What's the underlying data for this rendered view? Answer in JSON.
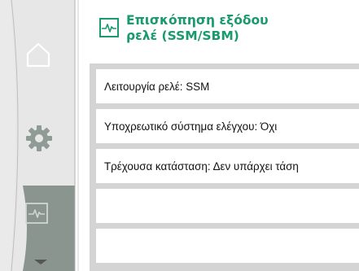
{
  "screen": {
    "title": "Επισκόπηση εξόδου\nρελέ (SSM/SBM)",
    "title_icon": "heartbeat-icon",
    "accent_color": "#1a9a6d"
  },
  "nav": {
    "items": [
      {
        "icon": "home-icon",
        "selected": false
      },
      {
        "icon": "gear-icon",
        "selected": false
      },
      {
        "icon": "heartbeat-icon",
        "selected": true
      }
    ],
    "scroll_icon": "chevron-down-icon"
  },
  "list": {
    "items": [
      {
        "text": "Λειτουργία ρελέ: SSM"
      },
      {
        "text": "Υποχρεωτικό σύστημα ελέγχου: Όχι"
      },
      {
        "text": "Τρέχουσα κατάσταση: Δεν υπάρχει τάση"
      },
      {
        "text": ""
      },
      {
        "text": ""
      }
    ]
  }
}
